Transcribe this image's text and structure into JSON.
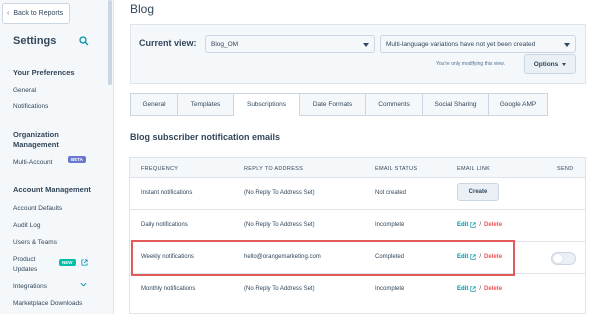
{
  "sidebar": {
    "back_label": "Back to Reports",
    "title": "Settings",
    "groups": [
      {
        "title": "Your Preferences",
        "items": [
          "General",
          "Notifications"
        ]
      },
      {
        "title_line1": "Organization",
        "title_line2": "Management",
        "items": [
          "Multi-Account"
        ]
      },
      {
        "title": "Account Management",
        "items": [
          "Account Defaults",
          "Audit Log",
          "Users & Teams",
          "Product",
          "Updates",
          "Integrations",
          "Marketplace Downloads"
        ]
      }
    ],
    "beta_badge": "BETA",
    "new_badge": "NEW"
  },
  "main": {
    "title": "Blog",
    "current_view_label": "Current view:",
    "blog_select": "Blog_OM",
    "language_select": "Multi-language variations have not yet been created",
    "modify_note": "You're only modifying this view.",
    "options_label": "Options",
    "tabs": [
      "General",
      "Templates",
      "Subscriptions",
      "Date Formats",
      "Comments",
      "Social Sharing",
      "Google AMP"
    ],
    "active_tab": "Subscriptions",
    "section_title": "Blog subscriber notification emails"
  },
  "table": {
    "headers": [
      "FREQUENCY",
      "REPLY TO ADDRESS",
      "EMAIL STATUS",
      "EMAIL LINK",
      "SEND"
    ],
    "rows": [
      {
        "frequency": "Instant notifications",
        "reply_to": "(No Reply To Address Set)",
        "status": "Not created",
        "action": "Create"
      },
      {
        "frequency": "Daily notifications",
        "reply_to": "(No Reply To Address Set)",
        "status": "Incomplete",
        "edit": "Edit",
        "delete": "Delete"
      },
      {
        "frequency": "Weekly notifications",
        "reply_to": "hello@orangemarketing.com",
        "status": "Completed",
        "edit": "Edit",
        "delete": "Delete"
      },
      {
        "frequency": "Monthly notifications",
        "reply_to": "(No Reply To Address Set)",
        "status": "Incomplete",
        "edit": "Edit",
        "delete": "Delete"
      }
    ],
    "separator": "/"
  },
  "colors": {
    "accent_link": "#0091ae",
    "delete_red": "#f2545b",
    "highlight_red": "#e35a5a",
    "beta_purple": "#6a78d1",
    "new_teal": "#00bda5"
  },
  "icons": [
    "chevron-left-icon",
    "search-icon",
    "external-link-icon",
    "chevron-down-icon"
  ]
}
